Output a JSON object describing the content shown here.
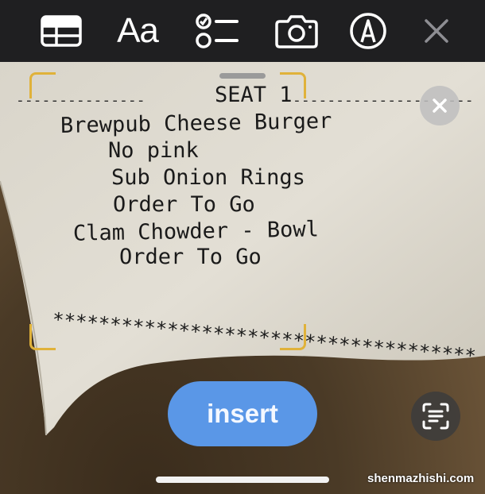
{
  "toolbar": {
    "icons": [
      "table-icon",
      "text-format-icon",
      "checklist-icon",
      "camera-icon",
      "markup-icon",
      "close-icon"
    ],
    "text_format_label": "Aa"
  },
  "receipt": {
    "header": "SEAT 1",
    "lines": [
      "Brewpub Cheese Burger",
      "No pink",
      "Sub Onion Rings",
      "Order To Go",
      "Clam Chowder - Bowl",
      "Order To Go"
    ],
    "stars": "*************************************"
  },
  "insert_button_label": "insert",
  "watermark": "shenmazhishi.com",
  "colors": {
    "toolbar_bg": "#1f1f21",
    "insert_blue": "#5a97e7",
    "corner_yellow": "#e0b23a"
  }
}
